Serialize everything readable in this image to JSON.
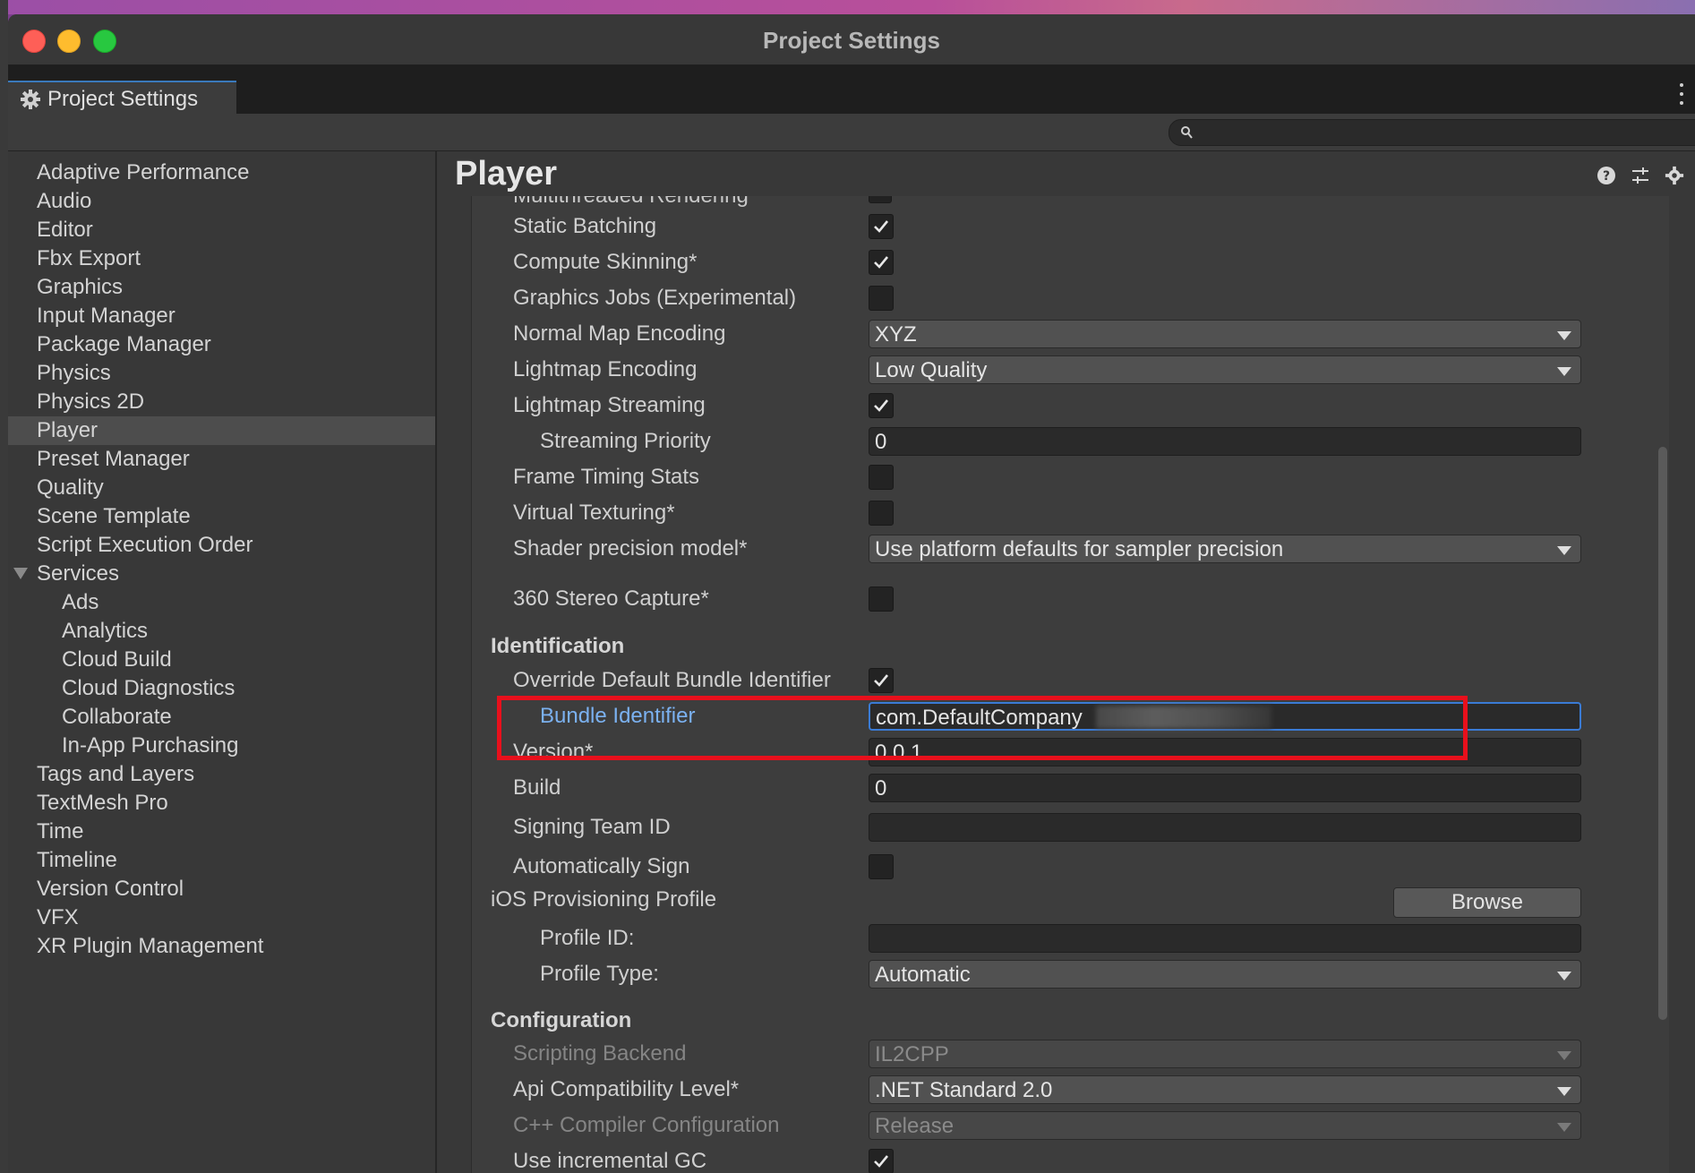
{
  "window": {
    "title": "Project Settings",
    "tab_label": "Project Settings",
    "search_placeholder": ""
  },
  "sidebar": {
    "items": [
      {
        "label": "Adaptive Performance"
      },
      {
        "label": "Audio"
      },
      {
        "label": "Editor"
      },
      {
        "label": "Fbx Export"
      },
      {
        "label": "Graphics"
      },
      {
        "label": "Input Manager"
      },
      {
        "label": "Package Manager"
      },
      {
        "label": "Physics"
      },
      {
        "label": "Physics 2D"
      },
      {
        "label": "Player",
        "selected": true
      },
      {
        "label": "Preset Manager"
      },
      {
        "label": "Quality"
      },
      {
        "label": "Scene Template"
      },
      {
        "label": "Script Execution Order"
      },
      {
        "label": "Services",
        "expanded": true
      },
      {
        "label": "Ads"
      },
      {
        "label": "Analytics"
      },
      {
        "label": "Cloud Build"
      },
      {
        "label": "Cloud Diagnostics"
      },
      {
        "label": "Collaborate"
      },
      {
        "label": "In-App Purchasing"
      },
      {
        "label": "Tags and Layers"
      },
      {
        "label": "TextMesh Pro"
      },
      {
        "label": "Time"
      },
      {
        "label": "Timeline"
      },
      {
        "label": "Version Control"
      },
      {
        "label": "VFX"
      },
      {
        "label": "XR Plugin Management"
      }
    ]
  },
  "main": {
    "title": "Player",
    "ghost_label": "Multithreaded Rendering",
    "settings": {
      "static_batching": {
        "label": "Static Batching",
        "checked": true
      },
      "compute_skinning": {
        "label": "Compute Skinning*",
        "checked": true
      },
      "graphics_jobs": {
        "label": "Graphics Jobs (Experimental)",
        "checked": false
      },
      "normal_map_encoding": {
        "label": "Normal Map Encoding",
        "value": "XYZ"
      },
      "lightmap_encoding": {
        "label": "Lightmap Encoding",
        "value": "Low Quality"
      },
      "lightmap_streaming": {
        "label": "Lightmap Streaming",
        "checked": true
      },
      "streaming_priority": {
        "label": "Streaming Priority",
        "value": "0"
      },
      "frame_timing_stats": {
        "label": "Frame Timing Stats",
        "checked": false
      },
      "virtual_texturing": {
        "label": "Virtual Texturing*",
        "checked": false
      },
      "shader_precision_model": {
        "label": "Shader precision model*",
        "value": "Use platform defaults for sampler precision"
      },
      "stereo_capture": {
        "label": "360 Stereo Capture*",
        "checked": false
      }
    },
    "identification": {
      "heading": "Identification",
      "override_bundle": {
        "label": "Override Default Bundle Identifier",
        "checked": true
      },
      "bundle_identifier": {
        "label": "Bundle Identifier",
        "value": "com.DefaultCompany"
      },
      "version": {
        "label": "Version*",
        "value": "0.0.1"
      },
      "build": {
        "label": "Build",
        "value": "0"
      },
      "signing_team_id": {
        "label": "Signing Team ID",
        "value": ""
      },
      "auto_sign": {
        "label": "Automatically Sign",
        "checked": false
      },
      "provisioning_profile": {
        "label": "iOS Provisioning Profile",
        "browse_label": "Browse"
      },
      "profile_id": {
        "label": "Profile ID:",
        "value": ""
      },
      "profile_type": {
        "label": "Profile Type:",
        "value": "Automatic"
      }
    },
    "configuration": {
      "heading": "Configuration",
      "scripting_backend": {
        "label": "Scripting Backend",
        "value": "IL2CPP"
      },
      "api_compat": {
        "label": "Api Compatibility Level*",
        "value": ".NET Standard 2.0"
      },
      "cpp_compiler": {
        "label": "C++ Compiler Configuration",
        "value": "Release"
      },
      "incremental_gc": {
        "label": "Use incremental GC",
        "checked": true
      }
    }
  },
  "colors": {
    "accent": "#3a7bd5",
    "highlight": "#e8101c",
    "link_label": "#7bb1f0"
  },
  "icons": [
    "gear-icon",
    "kebab-menu-icon",
    "search-icon",
    "help-icon",
    "presets-icon",
    "settings-icon",
    "checkmark-icon",
    "dropdown-arrow-icon",
    "foldout-triangle-icon"
  ]
}
